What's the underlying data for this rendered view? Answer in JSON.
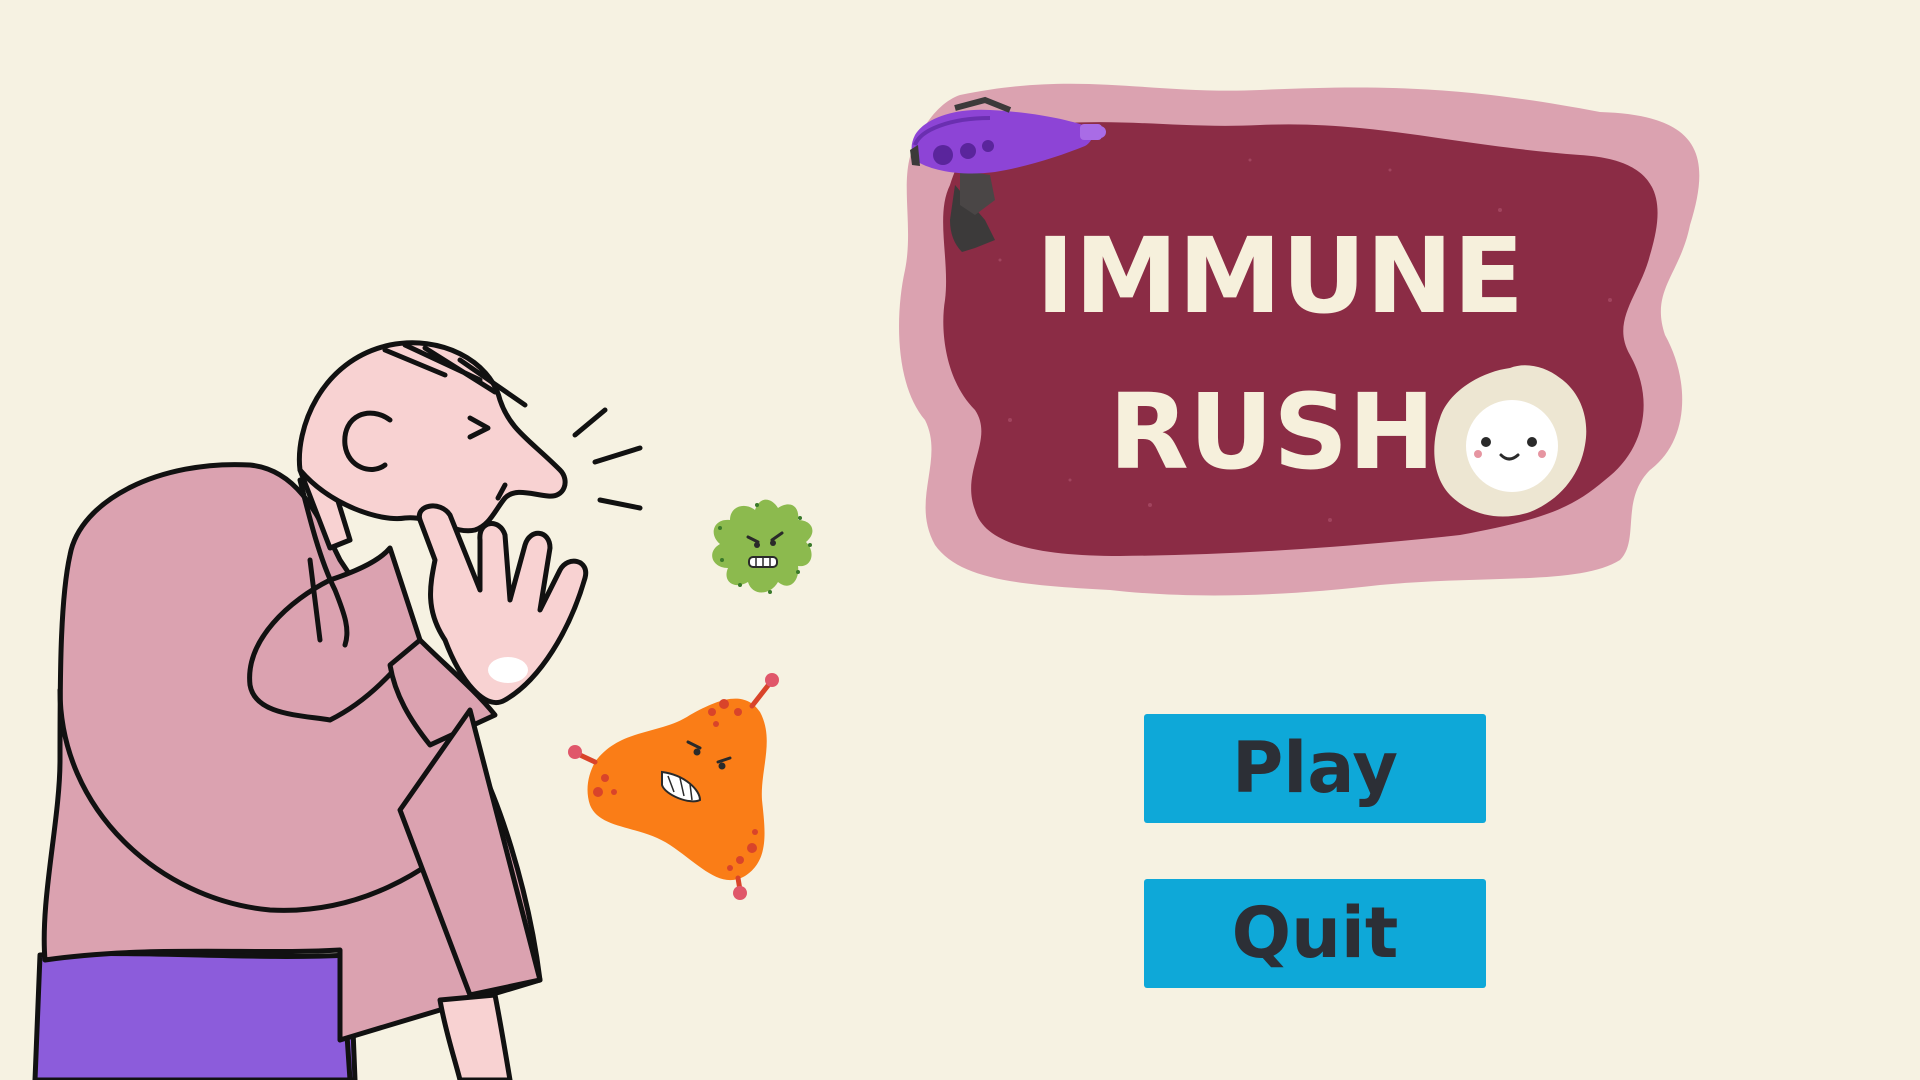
{
  "game": {
    "title_line1": "IMMUNE",
    "title_line2": "RUSH"
  },
  "menu": {
    "play_label": "Play",
    "quit_label": "Quit"
  },
  "colors": {
    "background": "#f6f2e2",
    "button": "#0ea8d8",
    "button_text": "#2c2f36",
    "title_panel": "#8b2c45",
    "title_panel_border": "#dba2b0",
    "title_text": "#f6f0dc"
  },
  "icons": {
    "character": "sneezing-man-illustration",
    "green_germ": "green-germ-icon",
    "orange_germ": "orange-virus-icon",
    "ray_gun": "ray-gun-icon",
    "white_cell": "white-blood-cell-icon"
  }
}
